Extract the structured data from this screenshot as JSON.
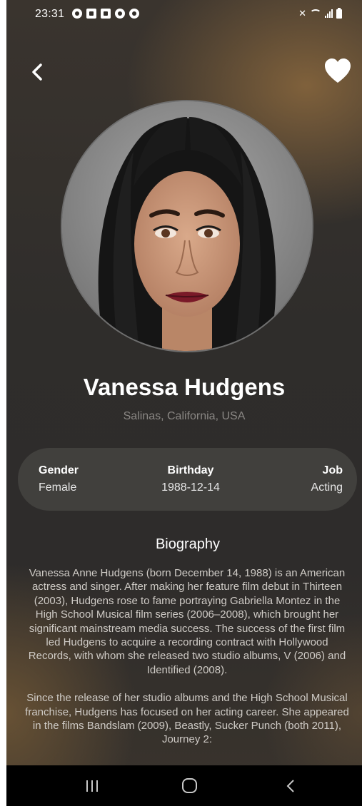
{
  "status_bar": {
    "time": "23:31",
    "icons_left": [
      "app-a-icon",
      "notification-icon",
      "gallery-icon",
      "vpn-icon",
      "record-icon"
    ],
    "icons_right": [
      "mute-icon",
      "wifi-icon",
      "signal-icon",
      "battery-icon"
    ]
  },
  "header": {
    "back_icon": "chevron-left-icon",
    "favorite_icon": "heart-icon"
  },
  "profile": {
    "name": "Vanessa Hudgens",
    "place_of_birth": "Salinas, California, USA"
  },
  "info": {
    "gender_label": "Gender",
    "gender_value": "Female",
    "birthday_label": "Birthday",
    "birthday_value": "1988-12-14",
    "job_label": "Job",
    "job_value": "Acting"
  },
  "biography": {
    "heading": "Biography",
    "paragraph_1": "Vanessa Anne Hudgens (born December 14, 1988) is an American actress and singer. After making her feature film debut in Thirteen (2003), Hudgens rose to fame portraying Gabriella Montez in the High School Musical film series (2006–2008), which brought her significant mainstream media success. The success of the first film led Hudgens to acquire a recording contract with Hollywood Records, with whom she released two studio albums, V (2006) and Identified (2008).",
    "paragraph_2": "Since the release of her studio albums and the High School Musical franchise, Hudgens has focused on her acting career. She appeared in the films Bandslam (2009), Beastly, Sucker Punch (both 2011), Journey 2:"
  },
  "nav_bar": {
    "recents_icon": "recents-icon",
    "home_icon": "home-icon",
    "back_icon": "back-icon"
  },
  "colors": {
    "background": "#2f2d2b",
    "accent_warm": "#8c693e",
    "card": "#464442",
    "secondary_text": "#8a8784",
    "nav_bar": "#000000"
  }
}
